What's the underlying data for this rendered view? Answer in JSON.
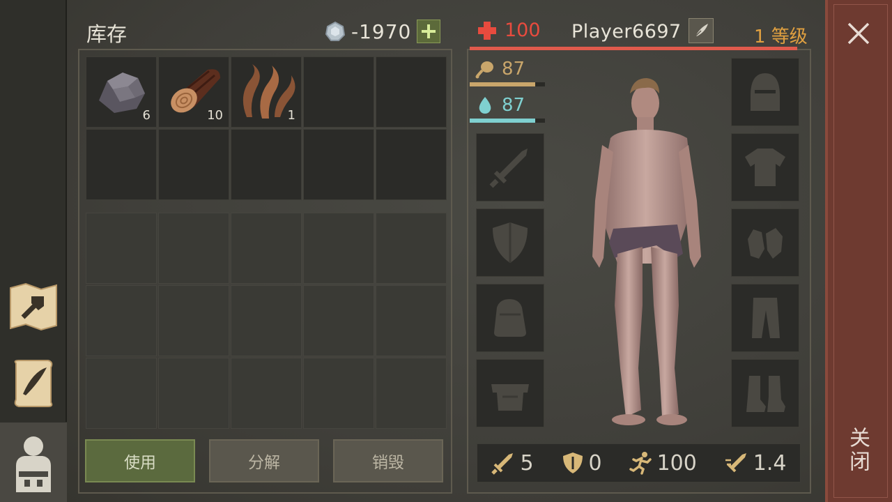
{
  "inventory": {
    "title": "库存",
    "currency_value": "-1970",
    "items": [
      {
        "name": "stone",
        "count": "6"
      },
      {
        "name": "log",
        "count": "10"
      },
      {
        "name": "plant-fiber",
        "count": "1"
      }
    ]
  },
  "actions": {
    "use_label": "使用",
    "disassemble_label": "分解",
    "destroy_label": "销毁"
  },
  "character": {
    "hp": "100",
    "food": "87",
    "water": "87",
    "food_level": 0.87,
    "water_level": 0.87,
    "player_name": "Player6697",
    "level_text": "1 等级"
  },
  "stats": {
    "attack": "5",
    "defense": "0",
    "speed": "100",
    "attack_speed": "1.4"
  },
  "close_label": "关闭",
  "colors": {
    "hp": "#e84b3e",
    "food": "#c9a66b",
    "water": "#7fd0d0",
    "level": "#e0a040",
    "close_bar": "#6e3a30"
  },
  "icons": {
    "left_tabs": [
      "crafting-map-icon",
      "journal-scroll-icon",
      "backpack-character-icon"
    ],
    "equipment_left": [
      "sword-icon",
      "shield-icon",
      "backpack-icon",
      "pouch-icon"
    ],
    "equipment_right": [
      "helmet-icon",
      "shirt-icon",
      "gloves-icon",
      "pants-icon",
      "boots-icon"
    ]
  }
}
